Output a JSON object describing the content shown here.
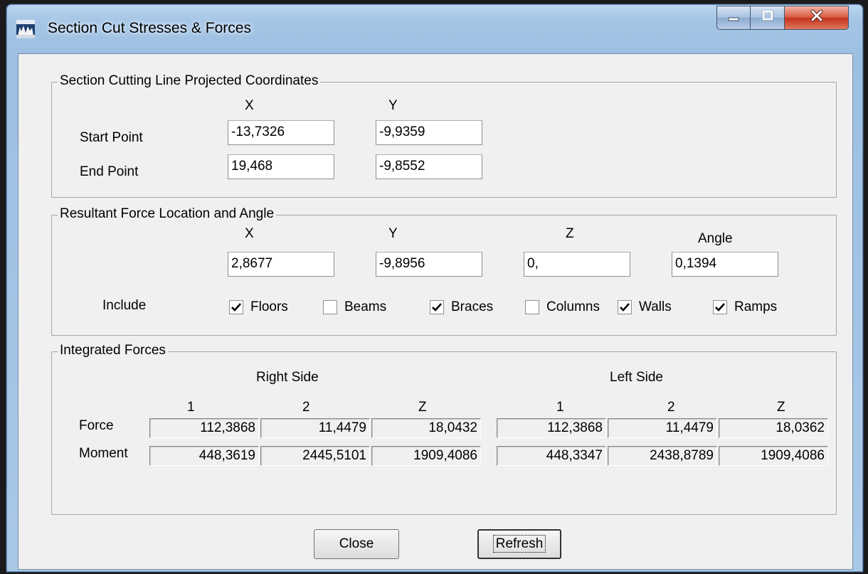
{
  "window": {
    "title": "Section Cut Stresses & Forces"
  },
  "section_cutting": {
    "title": "Section Cutting Line Projected Coordinates",
    "x_header": "X",
    "y_header": "Y",
    "start_label": "Start Point",
    "start_x": "-13,7326",
    "start_y": "-9,9359",
    "end_label": "End Point",
    "end_x": "19,468",
    "end_y": "-9,8552"
  },
  "resultant": {
    "title": "Resultant Force Location and Angle",
    "x_header": "X",
    "y_header": "Y",
    "z_header": "Z",
    "angle_header": "Angle",
    "x": "2,8677",
    "y": "-9,8956",
    "z": "0,",
    "angle": "0,1394",
    "include_label": "Include",
    "include": [
      {
        "label": "Floors",
        "checked": true
      },
      {
        "label": "Beams",
        "checked": false
      },
      {
        "label": "Braces",
        "checked": true
      },
      {
        "label": "Columns",
        "checked": false
      },
      {
        "label": "Walls",
        "checked": true
      },
      {
        "label": "Ramps",
        "checked": true
      }
    ]
  },
  "integrated": {
    "title": "Integrated Forces",
    "right_side": "Right Side",
    "left_side": "Left Side",
    "col_headers": [
      "1",
      "2",
      "Z",
      "1",
      "2",
      "Z"
    ],
    "force_label": "Force",
    "moment_label": "Moment",
    "force": [
      "112,3868",
      "11,4479",
      "18,0432",
      "112,3868",
      "11,4479",
      "18,0362"
    ],
    "moment": [
      "448,3619",
      "2445,5101",
      "1909,4086",
      "448,3347",
      "2438,8789",
      "1909,4086"
    ]
  },
  "buttons": {
    "close": "Close",
    "refresh": "Refresh"
  }
}
